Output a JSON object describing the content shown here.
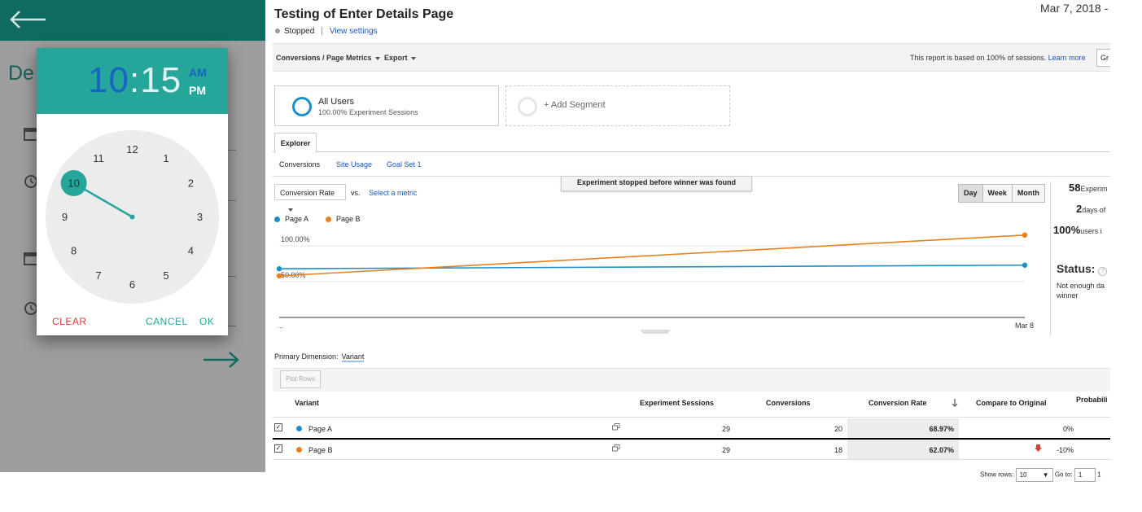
{
  "app": {
    "background_title": "De",
    "time_picker": {
      "hour": "10",
      "separator": ":",
      "minute": "15",
      "am": "AM",
      "pm": "PM",
      "selected_hour": 10,
      "dial_numbers": [
        "12",
        "1",
        "2",
        "3",
        "4",
        "5",
        "6",
        "7",
        "8",
        "9",
        "10",
        "11"
      ],
      "clear_label": "CLEAR",
      "cancel_label": "CANCEL",
      "ok_label": "OK",
      "accent_color": "#26a69a"
    }
  },
  "report": {
    "title": "Testing of Enter Details Page",
    "date_range": "Mar 7, 2018 -",
    "status": "Stopped",
    "view_settings": "View settings",
    "toolbar": {
      "conversions_menu": "Conversions / Page Metrics",
      "export_menu": "Export",
      "note": "This report is based on 100% of sessions.",
      "learn_more": "Learn more",
      "group_btn": "Gr"
    },
    "segments": [
      {
        "name": "All Users",
        "sub": "100.00% Experiment Sessions"
      },
      {
        "name": "+ Add Segment",
        "sub": ""
      }
    ],
    "explorer_tab": "Explorer",
    "subtabs": [
      "Conversions",
      "Site Usage",
      "Goal Set 1"
    ],
    "banner": "Experiment stopped before winner was found",
    "metric_select": "Conversion Rate",
    "vs_label": "vs.",
    "select_metric": "Select a metric",
    "range_buttons": [
      "Day",
      "Week",
      "Month"
    ],
    "range_selected": "Day",
    "right_panel": {
      "sessions_n": "58",
      "sessions_t": "Experim",
      "days_n": "2",
      "days_t": "days of",
      "users_n": "100%",
      "users_t": "users i",
      "status_label": "Status:",
      "status_text_1": "Not enough da",
      "status_text_2": "winner"
    },
    "primary_dimension_label": "Primary Dimension:",
    "primary_dimension_value": "Variant",
    "plot_rows": "Plot Rows",
    "table": {
      "headers": {
        "variant": "Variant",
        "sessions": "Experiment Sessions",
        "conversions": "Conversions",
        "rate": "Conversion Rate",
        "compare": "Compare to Original",
        "prob": "Probabili"
      },
      "rows": [
        {
          "name": "Page A",
          "sessions": "29",
          "conversions": "20",
          "rate": "68.97%",
          "compare": "0%"
        },
        {
          "name": "Page B",
          "sessions": "29",
          "conversions": "18",
          "rate": "62.07%",
          "compare": "-10%"
        }
      ]
    },
    "pager": {
      "show_rows_label": "Show rows:",
      "show_rows_value": "10",
      "goto_label": "Go to:",
      "goto_value": "1",
      "page_text": "1"
    }
  },
  "chart_data": {
    "type": "line",
    "x_labels": [
      "...",
      "Mar 8"
    ],
    "y_tick_labels": [
      "100.00%",
      "50.00%"
    ],
    "ylim": [
      0,
      125
    ],
    "grid": true,
    "legend_position": "top-left",
    "series": [
      {
        "name": "Page A",
        "color": "#1a8fc9",
        "values": [
          68,
          73
        ]
      },
      {
        "name": "Page B",
        "color": "#e8801e",
        "values": [
          58,
          115
        ]
      }
    ]
  }
}
